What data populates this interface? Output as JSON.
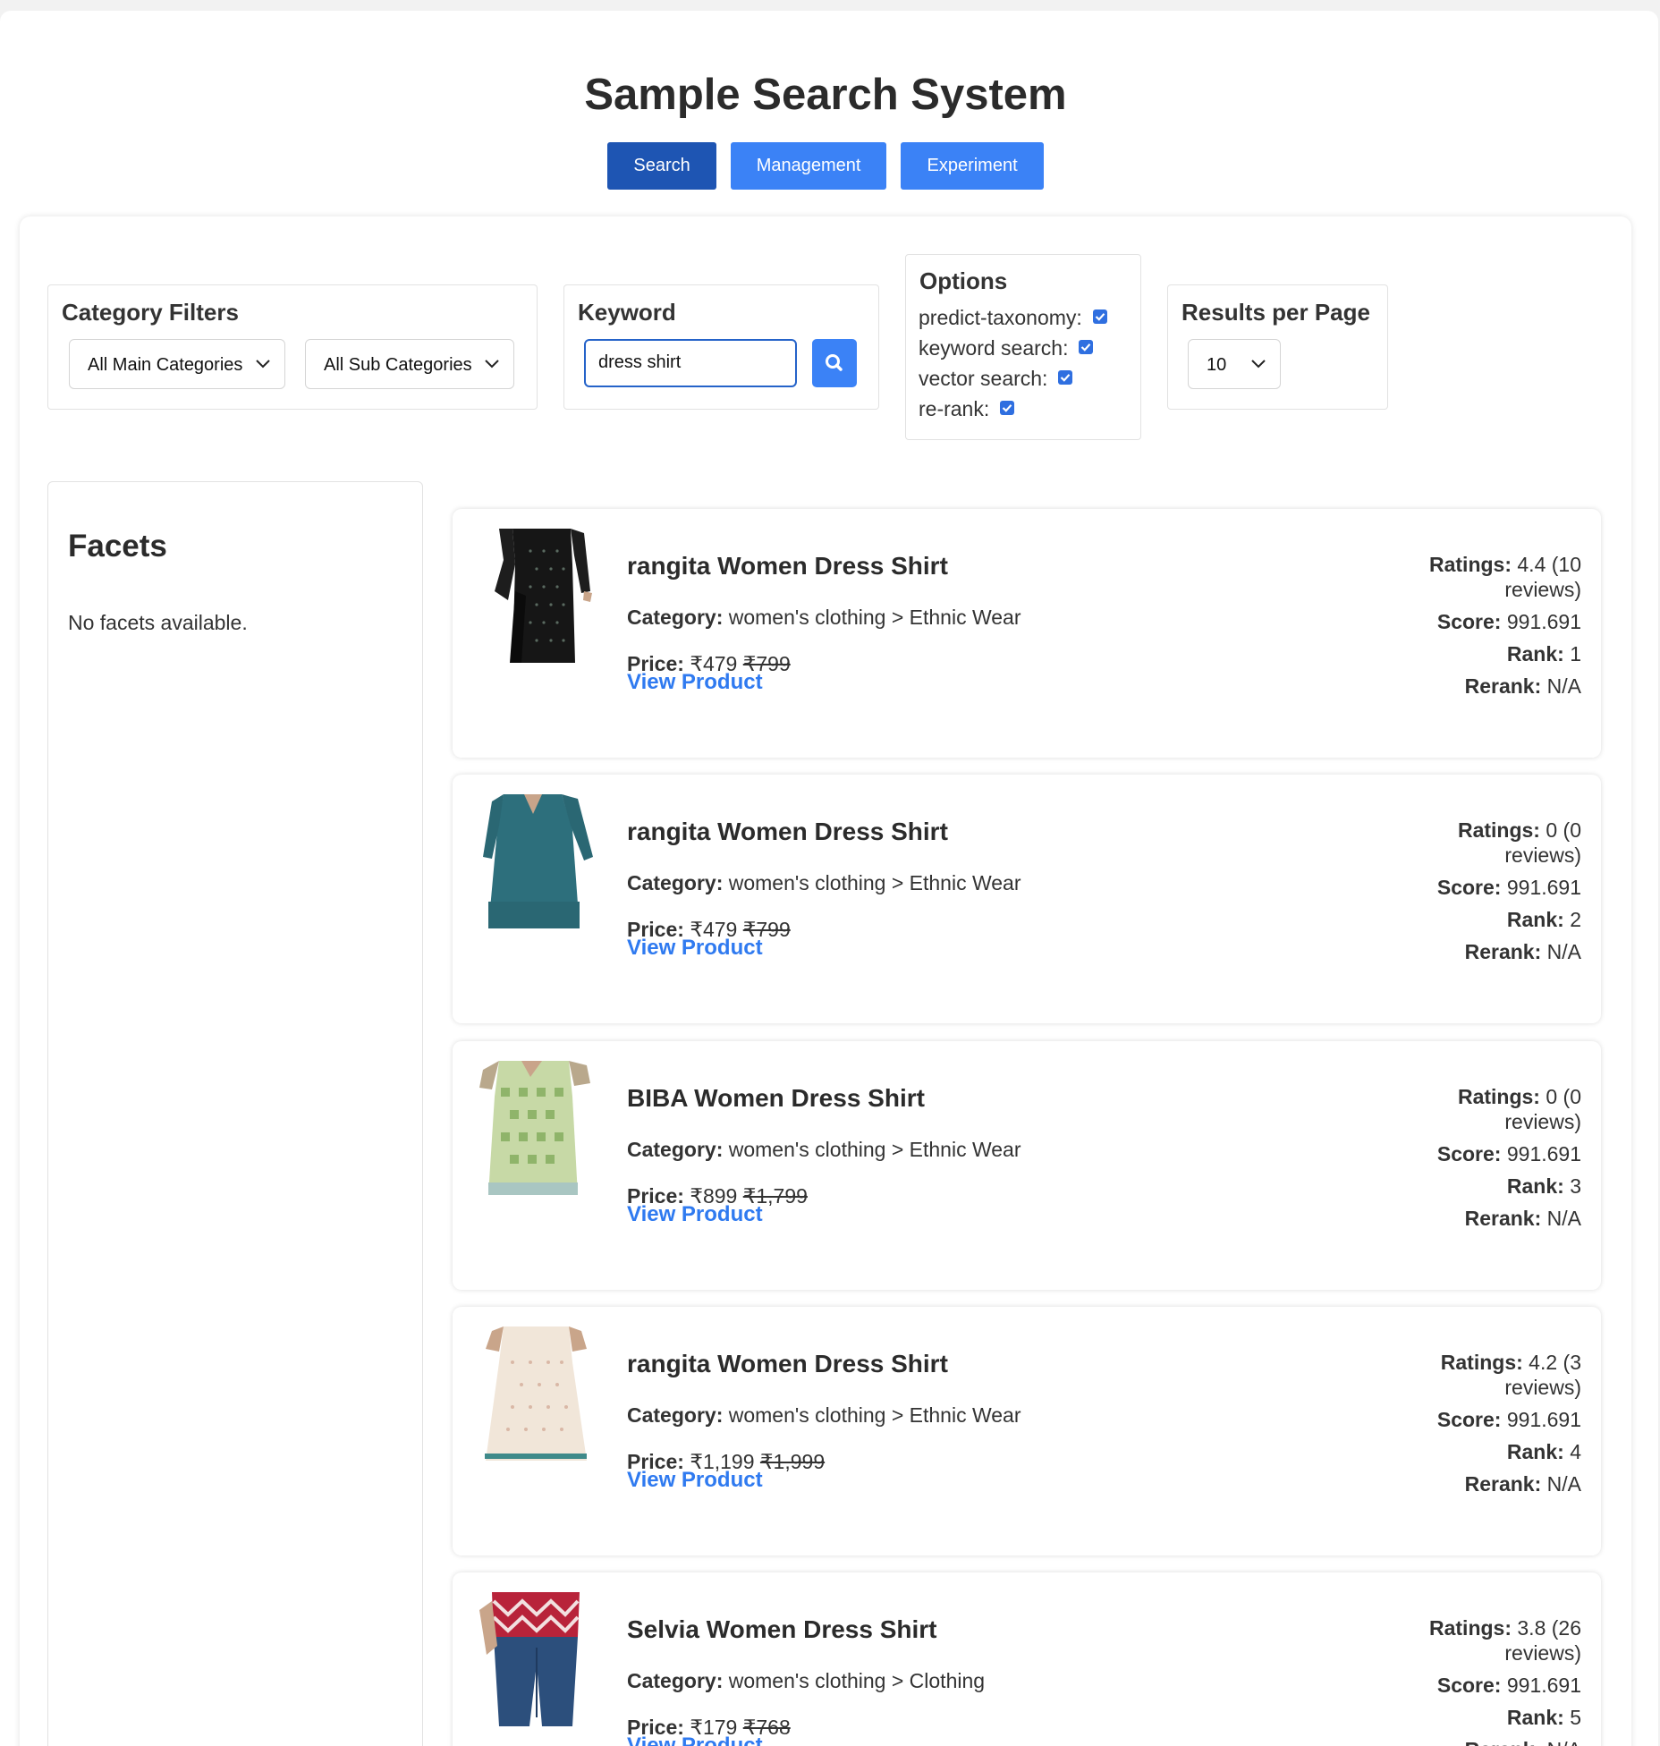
{
  "app": {
    "title": "Sample Search System"
  },
  "nav": {
    "tabs": [
      {
        "label": "Search"
      },
      {
        "label": "Management"
      },
      {
        "label": "Experiment"
      }
    ]
  },
  "filters": {
    "title": "Category Filters",
    "main_category": "All Main Categories",
    "sub_category": "All Sub Categories"
  },
  "keyword": {
    "title": "Keyword",
    "value": "dress shirt"
  },
  "options": {
    "title": "Options",
    "items": [
      {
        "label": "predict-taxonomy:",
        "checked": true
      },
      {
        "label": "keyword search:",
        "checked": true
      },
      {
        "label": "vector search:",
        "checked": true
      },
      {
        "label": "re-rank:",
        "checked": true
      }
    ]
  },
  "results_per_page": {
    "title": "Results per Page",
    "value": "10"
  },
  "facets": {
    "title": "Facets",
    "empty_text": "No facets available."
  },
  "labels": {
    "category": "Category:",
    "price": "Price:",
    "view_product": "View Product",
    "ratings": "Ratings:",
    "score": "Score:",
    "rank": "Rank:",
    "rerank": "Rerank:"
  },
  "results": [
    {
      "name": "rangita Women Dress Shirt",
      "category": "women's clothing > Ethnic Wear",
      "price": "₹479",
      "mrp": "₹799",
      "ratings_line1": "4.4 (10",
      "ratings_line2": "reviews)",
      "score": "991.691",
      "rank": "1",
      "rerank": "N/A",
      "thumb": "black-kurta"
    },
    {
      "name": "rangita Women Dress Shirt",
      "category": "women's clothing > Ethnic Wear",
      "price": "₹479",
      "mrp": "₹799",
      "ratings_line1": "0 (0",
      "ratings_line2": "reviews)",
      "score": "991.691",
      "rank": "2",
      "rerank": "N/A",
      "thumb": "teal-kurta"
    },
    {
      "name": "BIBA Women Dress Shirt",
      "category": "women's clothing > Ethnic Wear",
      "price": "₹899",
      "mrp": "₹1,799",
      "ratings_line1": "0 (0",
      "ratings_line2": "reviews)",
      "score": "991.691",
      "rank": "3",
      "rerank": "N/A",
      "thumb": "green-kurta"
    },
    {
      "name": "rangita Women Dress Shirt",
      "category": "women's clothing > Ethnic Wear",
      "price": "₹1,199",
      "mrp": "₹1,999",
      "ratings_line1": "4.2 (3",
      "ratings_line2": "reviews)",
      "score": "991.691",
      "rank": "4",
      "rerank": "N/A",
      "thumb": "cream-kurta"
    },
    {
      "name": "Selvia Women Dress Shirt",
      "category": "women's clothing > Clothing",
      "price": "₹179",
      "mrp": "₹768",
      "ratings_line1": "3.8 (26",
      "ratings_line2": "reviews)",
      "score": "991.691",
      "rank": "5",
      "rerank": "N/A",
      "thumb": "chevron-top"
    }
  ],
  "colors": {
    "primary": "#3b82f6",
    "primary_active": "#1e55b3",
    "link": "#2f7af0"
  }
}
